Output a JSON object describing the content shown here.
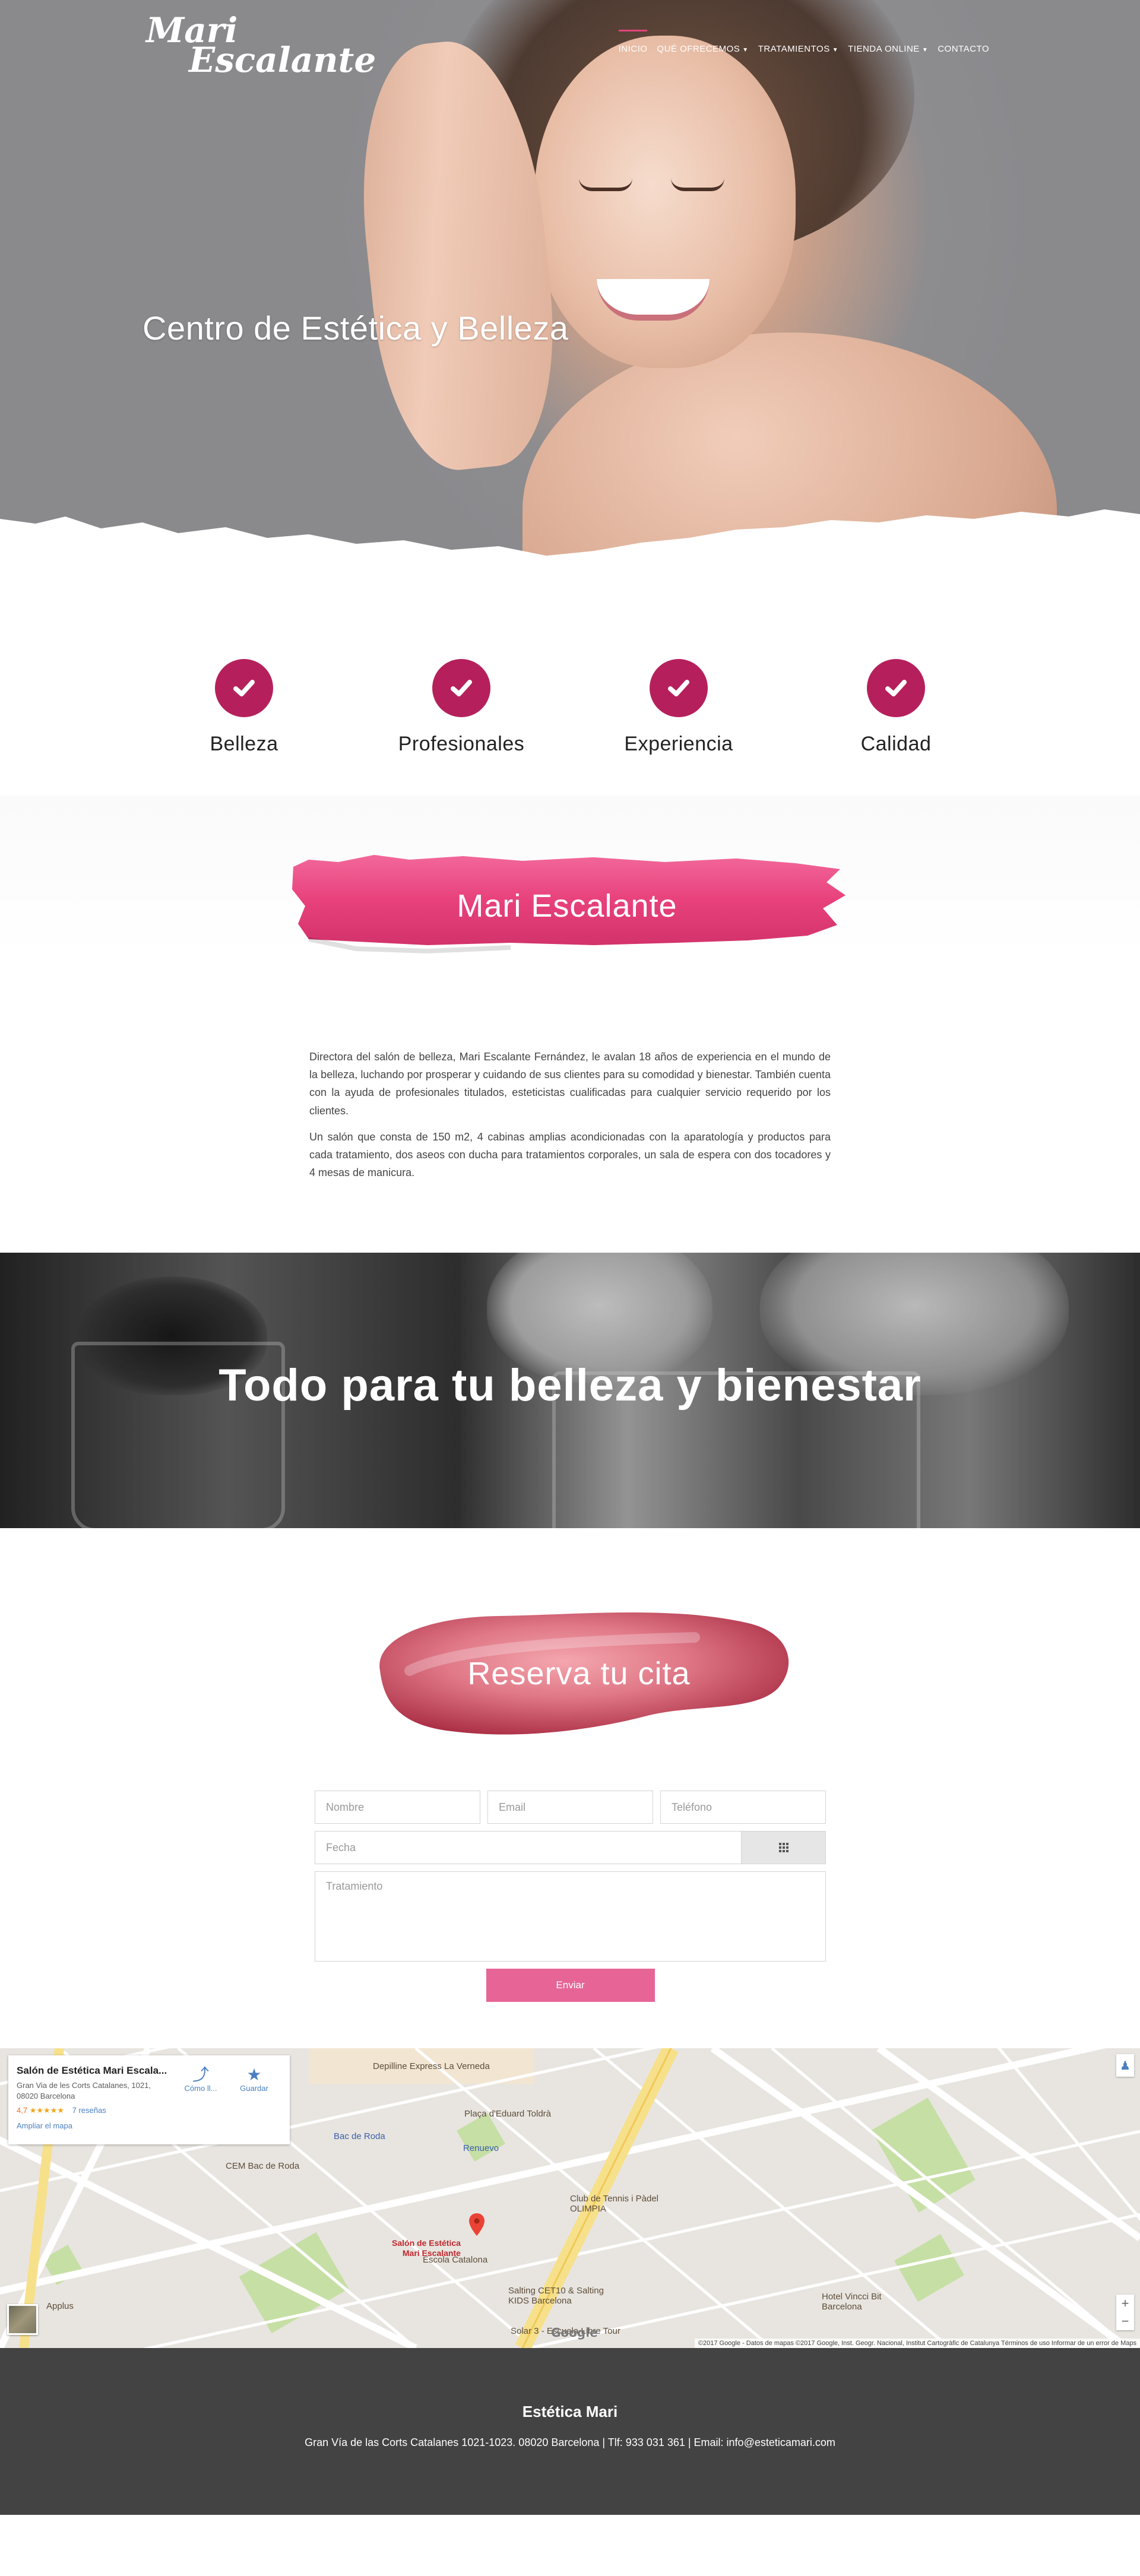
{
  "header": {
    "logo_line1": "Mari",
    "logo_line2": "Escalante",
    "nav": [
      {
        "label": "INICIO",
        "dropdown": false,
        "active": true
      },
      {
        "label": "QUÉ OFRECEMOS",
        "dropdown": true,
        "active": false
      },
      {
        "label": "TRATAMIENTOS",
        "dropdown": true,
        "active": false
      },
      {
        "label": "TIENDA ONLINE",
        "dropdown": true,
        "active": false
      },
      {
        "label": "CONTACTO",
        "dropdown": false,
        "active": false
      }
    ],
    "hero_title": "Centro de Estética y Belleza"
  },
  "features": [
    "Belleza",
    "Profesionales",
    "Experiencia",
    "Calidad"
  ],
  "about": {
    "title": "Mari Escalante",
    "paragraph1": "Directora del salón de belleza, Mari Escalante Fernández, le avalan 18 años de experiencia en el mundo de la belleza, luchando por prosperar y cuidando de sus clientes para su comodidad y bienestar. También cuenta con la ayuda de profesionales titulados, esteticistas cualificadas para cualquier servicio requerido por los clientes.",
    "paragraph2": "Un salón que consta de 150 m2, 4 cabinas amplias acondicionadas con la aparatología y productos para cada tratamiento, dos aseos con ducha para tratamientos corporales, un sala de espera con dos tocadores y 4 mesas de manicura."
  },
  "banner": {
    "title": "Todo para tu belleza y bienestar"
  },
  "booking": {
    "title": "Reserva tu cita",
    "name_placeholder": "Nombre",
    "email_placeholder": "Email",
    "phone_placeholder": "Teléfono",
    "date_placeholder": "Fecha",
    "treatment_placeholder": "Tratamiento",
    "submit_label": "Enviar"
  },
  "map": {
    "business_name": "Salón de Estética Mari Escala...",
    "address": "Gran Via de les Corts Catalanes, 1021, 08020 Barcelona",
    "rating": "4,7",
    "stars": "★★★★★",
    "reviews": "7 reseñas",
    "enlarge": "Ampliar el mapa",
    "directions_label": "Cómo ll...",
    "save_label": "Guardar",
    "pin_label_line1": "Salón de Estética",
    "pin_label_line2": "Mari Escalante",
    "places": {
      "depilline": "Depilline Express La Verneda",
      "placa": "Plaça d'Eduard Toldrà",
      "renueva": "Renuevo",
      "cem": "CEM Bac de Roda",
      "bacderoda": "Bac de Roda",
      "club": "Club de Tennis i Pàdel OLIMPIA",
      "escola": "Escola Catalona",
      "salting": "Salting CET10 & Salting KIDS Barcelona",
      "vincci": "Hotel Vincci Bit Barcelona",
      "applus": "Applus",
      "solar": "Solar 3 - Escuela Libre Tour"
    },
    "google": "Google",
    "attribution": "©2017 Google - Datos de mapas ©2017 Google, Inst. Geogr. Nacional, Institut Cartogràfic de Catalunya   Términos de uso   Informar de un error de Maps"
  },
  "footer": {
    "title": "Estética Mari",
    "info": "Gran Vía de las Corts Catalanes 1021-1023. 08020 Barcelona  |  Tlf: 933 031 361  |  Email: info@esteticamari.com"
  },
  "colors": {
    "accent": "#b5205c",
    "button": "#e66596",
    "footer": "#434343"
  }
}
